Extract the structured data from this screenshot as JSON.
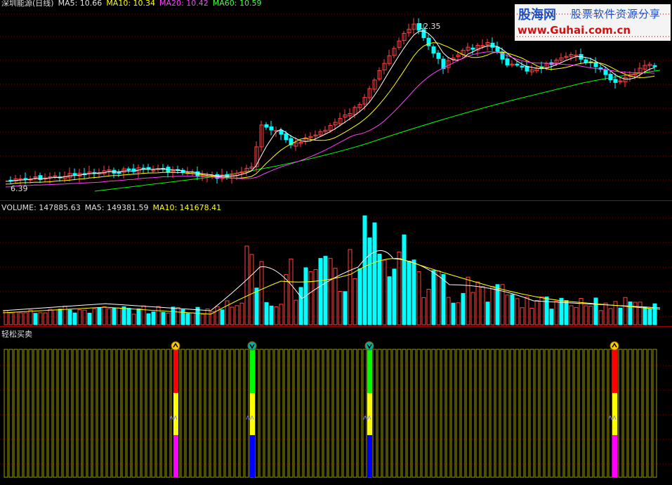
{
  "price_panel": {
    "title": "深圳能源(日线)",
    "ma5": "MA5: 10.66",
    "ma10": "MA10: 10.34",
    "ma20": "MA20: 10.42",
    "ma60": "MA60: 10.59",
    "high_label": "12.35",
    "low_label": "6.39"
  },
  "volume_panel": {
    "volume": "VOLUME: 147885.63",
    "ma5": "MA5: 149381.59",
    "ma10": "MA10: 141678.41"
  },
  "indicator_panel": {
    "title": "轻松买卖"
  },
  "watermark": {
    "brand": "股海网",
    "slogan": "股票软件资源分享",
    "url": "www.Guhai.com.cn"
  },
  "colors": {
    "up": "#ff4040",
    "down": "#00ffff",
    "ma5": "#ffffff",
    "ma10": "#ffff00",
    "ma20": "#ff40ff",
    "ma60": "#00ff00",
    "grid": "#800000",
    "bars": "#9a9a00"
  },
  "signals": [
    {
      "type": "buy",
      "icon": "up-arrow-circle-icon"
    },
    {
      "type": "sell",
      "icon": "down-arrow-circle-icon"
    },
    {
      "type": "sell",
      "icon": "down-arrow-circle-icon"
    },
    {
      "type": "buy",
      "icon": "up-arrow-circle-icon"
    }
  ]
}
